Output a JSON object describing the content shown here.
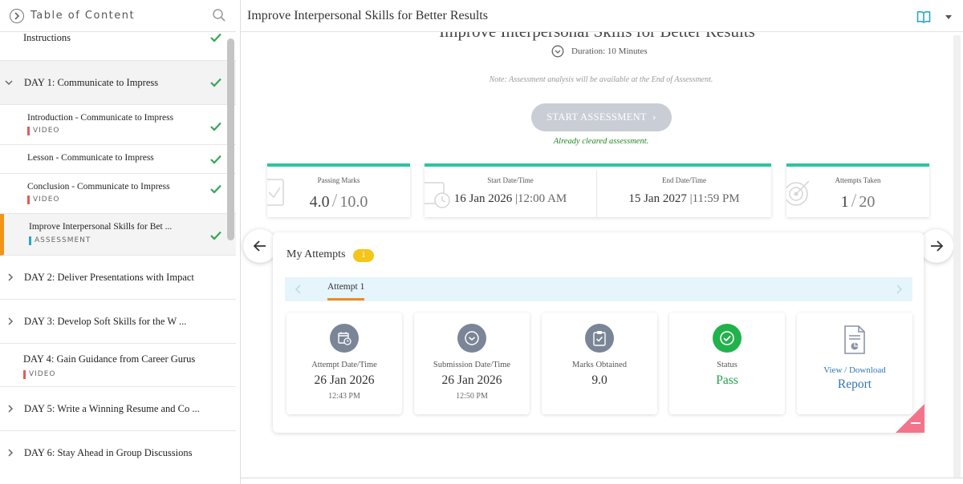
{
  "sidebar": {
    "header_title": "Table of Content",
    "items": [
      {
        "label": "Instructions",
        "completed": true
      },
      {
        "label": "DAY 1: Communicate to Impress",
        "expanded": true,
        "completed": true
      },
      {
        "label": "Introduction - Communicate to Impress",
        "tag": "VIDEO",
        "completed": true
      },
      {
        "label": "Lesson - Communicate to Impress",
        "completed": true
      },
      {
        "label": "Conclusion - Communicate to Impress",
        "tag": "VIDEO",
        "completed": true
      },
      {
        "label": "Improve Interpersonal Skills for Bet ...",
        "tag": "ASSESSMENT",
        "completed": true,
        "active": true
      },
      {
        "label": "DAY 2: Deliver Presentations with Impact"
      },
      {
        "label": "DAY 3: Develop Soft Skills for the W ..."
      },
      {
        "label": "DAY 4: Gain Guidance from Career Gurus",
        "tag": "VIDEO"
      },
      {
        "label": "DAY 5: Write a Winning Resume and Co ..."
      },
      {
        "label": "DAY 6: Stay Ahead in Group Discussions"
      }
    ]
  },
  "topbar": {
    "title": "Improve Interpersonal Skills for Better Results"
  },
  "assessment": {
    "title": "Improve Interpersonal Skills for Better Results",
    "duration": "Duration: 10 Minutes",
    "note": "Note: Assessment analysis will be available at the End of Assessment.",
    "start_button": "START ASSESSMENT",
    "cleared_text": "Already cleared assessment."
  },
  "stats": {
    "passing_label": "Passing Marks",
    "passing_value": "4.0",
    "passing_total": "10.0",
    "start_label": "Start Date/Time",
    "start_date": "16 Jan 2026",
    "start_time": "|12:00 AM",
    "end_label": "End Date/Time",
    "end_date": "15 Jan 2027",
    "end_time": "|11:59 PM",
    "attempts_label": "Attempts Taken",
    "attempts_value": "1",
    "attempts_total": "20"
  },
  "attempts": {
    "title": "My Attempts",
    "count": "1",
    "tab_label": "Attempt 1",
    "attempt_date_label": "Attempt Date/Time",
    "attempt_date": "26 Jan 2026",
    "attempt_time": "12:43 PM",
    "submission_label": "Submission Date/Time",
    "submission_date": "26 Jan 2026",
    "submission_time": "12:50 PM",
    "marks_label": "Marks Obtained",
    "marks_value": "9.0",
    "status_label": "Status",
    "status_value": "Pass",
    "report_label": "View / Download",
    "report_link": "Report"
  },
  "colors": {
    "accent_orange": "#f39418",
    "stat_top": "#2ec4a0",
    "pass_green": "#21b24b",
    "link_blue": "#2f77b5",
    "badge_yellow": "#f5c518"
  }
}
